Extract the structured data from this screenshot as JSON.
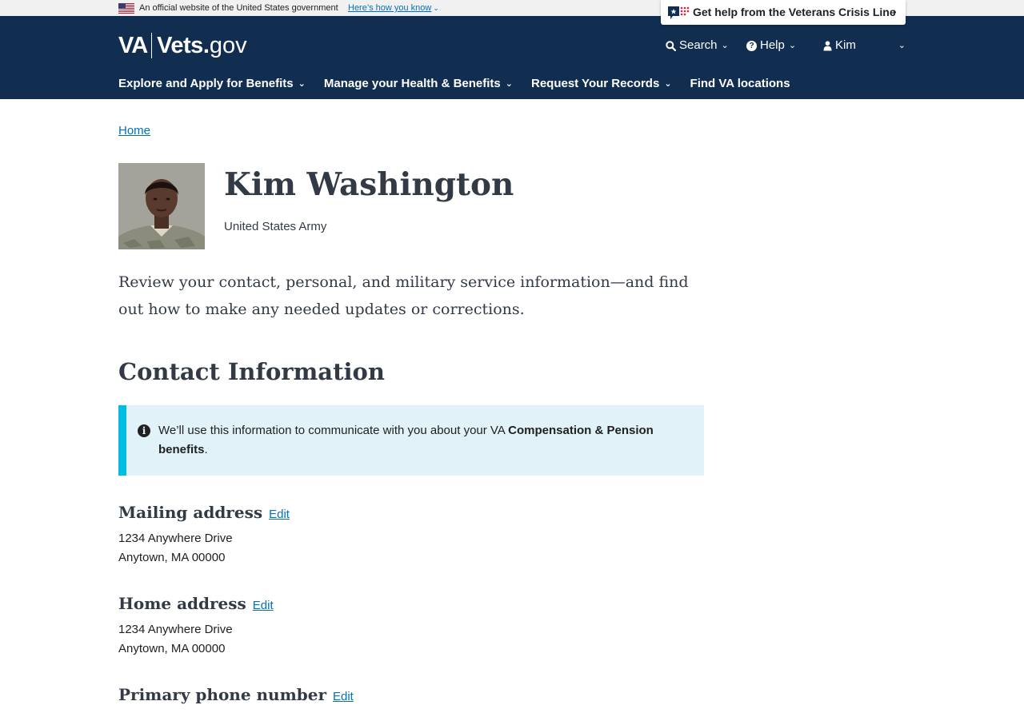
{
  "banner": {
    "official_text": "An official website of the United States government",
    "how_you_know": "Here’s how you know"
  },
  "crisis_line": {
    "label": "Get help from the Veterans Crisis Line"
  },
  "header": {
    "logo": {
      "va": "VA",
      "vets": "Vets",
      "dot": ".",
      "gov": "gov"
    },
    "search_label": "Search",
    "help_label": "Help",
    "user_label": "Kim",
    "nav": [
      {
        "label": "Explore and Apply for Benefits",
        "has_dropdown": true
      },
      {
        "label": "Manage your Health & Benefits",
        "has_dropdown": true
      },
      {
        "label": "Request Your Records",
        "has_dropdown": true
      },
      {
        "label": "Find VA locations",
        "has_dropdown": false
      }
    ]
  },
  "breadcrumb": {
    "home": "Home"
  },
  "profile": {
    "name": "Kim Washington",
    "branch": "United States Army"
  },
  "intro": "Review your contact, personal, and military service information—and find out how to make any needed updates or corrections.",
  "contact": {
    "title": "Contact Information",
    "alert": {
      "text_before": "We’ll use this information to communicate with you about your VA ",
      "text_bold": "Compensation & Pension benefits",
      "text_after": "."
    },
    "edit_label": "Edit",
    "mailing": {
      "title": "Mailing address",
      "line1": "1234 Anywhere Drive",
      "line2": "Anytown, MA 00000"
    },
    "home": {
      "title": "Home address",
      "line1": "1234 Anywhere Drive",
      "line2": "Anytown, MA 00000"
    },
    "phone": {
      "title": "Primary phone number"
    }
  },
  "colors": {
    "header_bg": "#112e51",
    "link": "#0071bb",
    "alert_bg": "#e1f3f8",
    "alert_border": "#00bde3",
    "heading": "#323a45"
  }
}
